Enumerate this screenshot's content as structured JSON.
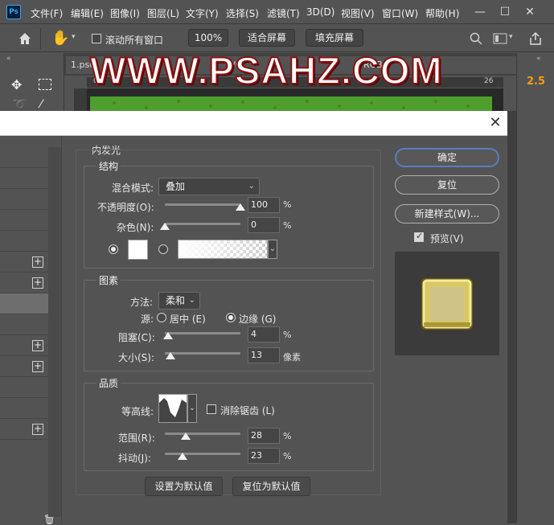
{
  "app": {
    "logo": "Ps"
  },
  "menu": [
    "文件(F)",
    "编辑(E)",
    "图像(I)",
    "图层(L)",
    "文字(Y)",
    "选择(S)",
    "滤镜(T)",
    "3D(D)",
    "视图(V)",
    "窗口(W)",
    "帮助(H)"
  ],
  "options_bar": {
    "scroll_all_label": "滚动所有窗口",
    "zoom_100": "100%",
    "fit_screen": "适合屏幕",
    "fill_screen": "填充屏幕"
  },
  "document": {
    "tab_title": "1.psd",
    "tab_suffix": "8/C",
    "tab_mode": "RGB",
    "ruler_labels": [
      "0",
      "26"
    ]
  },
  "right_panel": {
    "value": "2.5"
  },
  "watermark": "WWW.PSAHZ.COM",
  "dialog": {
    "section_title": "内发光",
    "structure": {
      "title": "结构",
      "blend_mode_label": "混合模式:",
      "blend_mode_value": "叠加",
      "opacity_label": "不透明度(O):",
      "opacity_value": "100",
      "opacity_percent": 100,
      "noise_label": "杂色(N):",
      "noise_value": "0",
      "noise_percent": 0,
      "percent_unit": "%"
    },
    "elements": {
      "title": "图素",
      "method_label": "方法:",
      "method_value": "柔和",
      "source_label": "源:",
      "source_center": "居中 (E)",
      "source_edge": "边缘 (G)",
      "source_selected": "edge",
      "choke_label": "阻塞(C):",
      "choke_value": "4",
      "choke_percent": 4,
      "size_label": "大小(S):",
      "size_value": "13",
      "size_percent": 7,
      "size_unit": "像素",
      "percent_unit": "%"
    },
    "quality": {
      "title": "品质",
      "contour_label": "等高线:",
      "antialias_label": "消除锯齿 (L)",
      "antialias_checked": false,
      "range_label": "范围(R):",
      "range_value": "28",
      "range_percent": 28,
      "jitter_label": "抖动(J):",
      "jitter_value": "23",
      "jitter_percent": 23,
      "percent_unit": "%"
    },
    "set_default": "设置为默认值",
    "reset_default": "复位为默认值",
    "ok": "确定",
    "reset": "复位",
    "new_style": "新建样式(W)...",
    "preview_label": "预览(V)",
    "preview_checked": true
  },
  "colors": {
    "glow_color": "#ffffff",
    "preview_tile": "#c8b45a",
    "canvas_green": "#4f9e2e",
    "accent_orange": "#f39c12",
    "watermark_stroke": "#8b1010"
  }
}
